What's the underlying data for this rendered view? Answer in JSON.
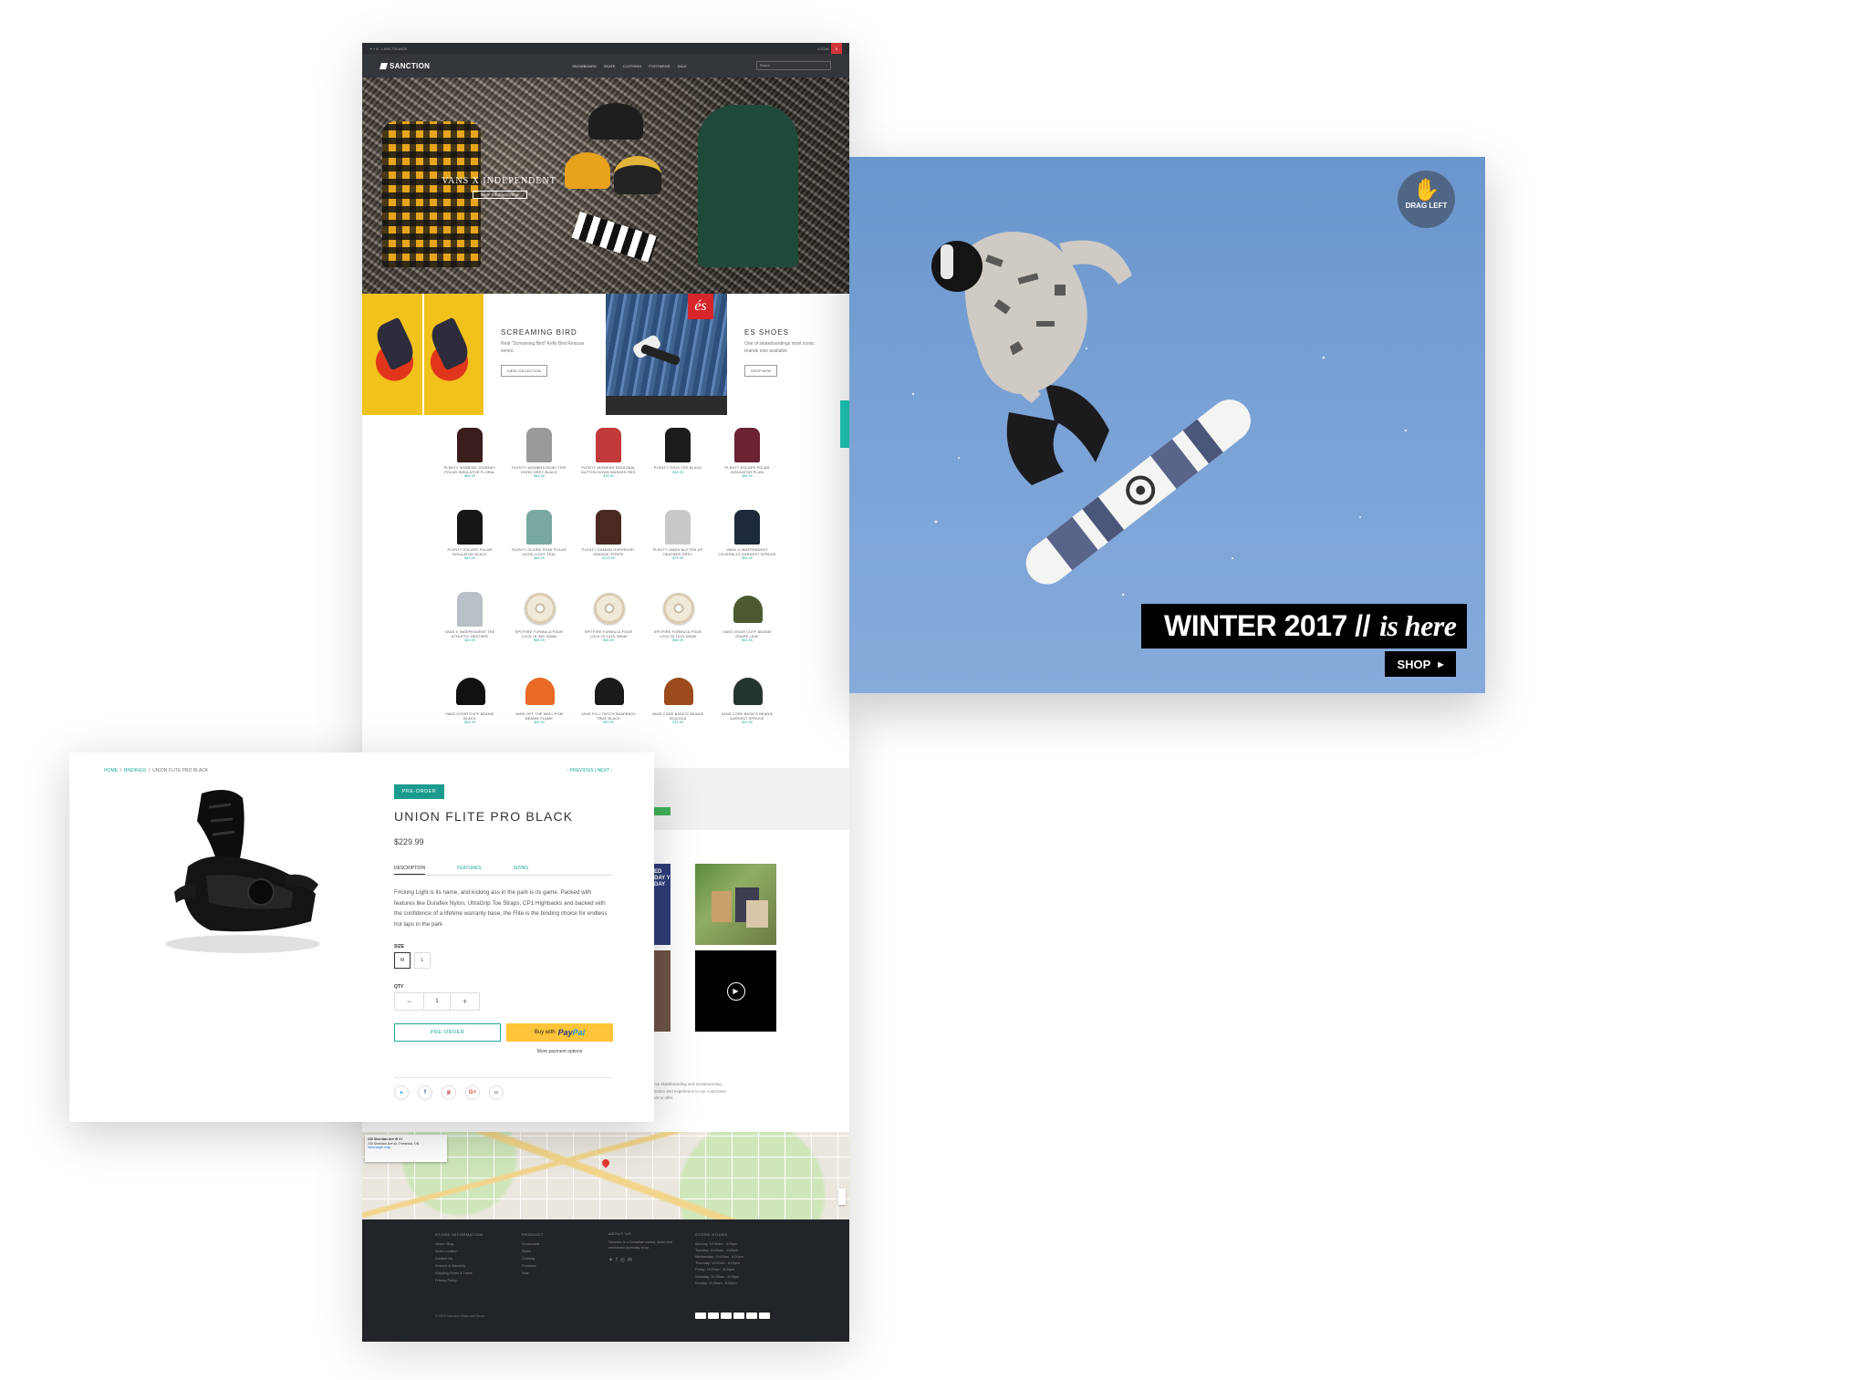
{
  "site": {
    "topbar": {
      "phone": "1-800-728-8625",
      "login": "LOGIN",
      "cart_count": "0"
    },
    "logo_text": "SANCTION",
    "nav": [
      "SNOWBOARD",
      "SKATE",
      "CLOTHING",
      "FOOTWEAR",
      "SALE"
    ],
    "search_placeholder": "Search",
    "hero": {
      "title": "VANS X INDEPENDENT",
      "button": "SHOP THE COLLECTION"
    },
    "promos": [
      {
        "title": "SCREAMING BIRD",
        "text": "Real \"Screaming Bird\" Kelly Bird Reissue series.",
        "button": "VIEW COLLECTION"
      },
      {
        "title": "ES SHOES",
        "text": "One of skateboardings most iconic brands now available",
        "button": "SHOP NOW"
      }
    ],
    "side_tab": "SIGNUP",
    "products": [
      {
        "name": "PLENTY WOMENS JOURNEY POLAR INSULATOR FLORAL",
        "price": "$59.99",
        "kind": "shirt",
        "color": "#3a1d1d"
      },
      {
        "name": "PLENTY WOMENS ROAD TRIP HOOD GREY BLACK",
        "price": "$64.99",
        "kind": "shirt",
        "color": "#9a9a9a"
      },
      {
        "name": "PLENTY WOMENS SEASONAL BUTTON DOWN WASHED RED",
        "price": "$79.99",
        "kind": "shirt",
        "color": "#c23a3a"
      },
      {
        "name": "PLENTY THUG TEE BLACK",
        "price": "$34.99",
        "kind": "shirt",
        "color": "#1c1c1c"
      },
      {
        "name": "PLENTY ESCAPE POLAR INSULATOR PLUM",
        "price": "$49.99",
        "kind": "shirt",
        "color": "#6b2233"
      },
      {
        "name": "PLENTY ESCAPE POLAR INSULATOR BLACK",
        "price": "$49.99",
        "kind": "shirt",
        "color": "#161616"
      },
      {
        "name": "PLENTY OLIVER PEAK POLAR HOOD LIGHT TEAL",
        "price": "$69.99",
        "kind": "shirt",
        "color": "#78a8a0"
      },
      {
        "name": "PLENTY DAMIAN OVERSHIRT ORANGE STRIPE",
        "price": "$119.99",
        "kind": "shirt",
        "color": "#4a2a20"
      },
      {
        "name": "PLENTY OWEN BUTTON UP HEATHER GREY",
        "price": "$74.99",
        "kind": "shirt",
        "color": "#c8c8c8"
      },
      {
        "name": "VANS X INDEPENDENT COVERALLS DARKEST SPRUCE",
        "price": "$95.00",
        "kind": "shirt",
        "color": "#1c2a3c"
      },
      {
        "name": "VANS X INDEPENDENT TEE ATHLETIC HEATHER",
        "price": "$29.99",
        "kind": "shirt",
        "color": "#b9bfc6"
      },
      {
        "name": "SPITFIRE FORMULA FOUR LOCK IN 99D 52MM",
        "price": "$54.99",
        "kind": "wheel",
        "color": "#f1e9d8"
      },
      {
        "name": "SPITFIRE FORMULA FOUR LOCK IN 101D 53MM",
        "price": "$56.99",
        "kind": "wheel",
        "color": "#f1e9d8"
      },
      {
        "name": "SPITFIRE FORMULA FOUR LOCK IN 101D 53MM",
        "price": "$56.99",
        "kind": "wheel",
        "color": "#f1e9d8"
      },
      {
        "name": "VANS VISOR CUFF BEANIE GRAPE LEAF",
        "price": "$24.99",
        "kind": "beanie",
        "color": "#4d5a31"
      },
      {
        "name": "VANS VISOR CUFF BEANIE BLACK",
        "price": "$24.99",
        "kind": "beanie",
        "color": "#111111"
      },
      {
        "name": "VANS OFF THE WALL POM BEANIE FLAME",
        "price": "$29.99",
        "kind": "beanie",
        "color": "#e86a24"
      },
      {
        "name": "VANS FULL PATCH SNAPBACK TRUE BLACK",
        "price": "$29.99",
        "kind": "beanie",
        "color": "#1a1a1a"
      },
      {
        "name": "VANS CORE BASICS BEANIE SEQUOIA",
        "price": "$19.99",
        "kind": "beanie",
        "color": "#9c4a1e"
      },
      {
        "name": "VANS CORE BASICS BEANIE DARKEST SPRUCE",
        "price": "$19.99",
        "kind": "beanie",
        "color": "#23362d"
      }
    ],
    "instagram_text": "ED DAY Y DAY",
    "about_snippet": [
      "love skateboarding and snowboarding",
      "llection and experience to our customers",
      "ave to offer."
    ],
    "map_card": {
      "title": "230 Sheridan Ave W #1",
      "address": "230 Sheridan Ave W, Threshold, ON",
      "link": "View larger map"
    },
    "footer": {
      "columns": [
        {
          "title": "STORE INFORMATION",
          "items": [
            "News / Blog",
            "Store Location",
            "Contact Us",
            "Returns & Warranty",
            "Shipping Terms & Taxes",
            "Privacy Policy"
          ]
        },
        {
          "title": "PRODUCT",
          "items": [
            "Snowboard",
            "Skate",
            "Clothing",
            "Footwear",
            "Sale"
          ]
        },
        {
          "title": "ABOUT US",
          "items": [
            "Sanction is a Canadian owned, skate and snowboard specialty shop."
          ]
        },
        {
          "title": "STORE HOURS",
          "items": [
            "Monday: 10:00am - 6:00pm",
            "Tuesday: 10:00am - 6:00pm",
            "Wednesday: 10:00am - 6:00pm",
            "Thursday: 10:00am - 8:00pm",
            "Friday: 10:00am - 8:00pm",
            "Saturday: 10:00am - 6:00pm",
            "Sunday: 11:00am - 5:00pm"
          ]
        }
      ],
      "copyright": "© 2018 Sanction Skate and Snow"
    }
  },
  "banner": {
    "drag_label": "DRAG LEFT",
    "headline": "WINTER 2017 //",
    "headline_script": "is here",
    "shop": "SHOP"
  },
  "product": {
    "breadcrumb": [
      "HOME",
      "BINDINGS",
      "UNION FLITE PRO BLACK"
    ],
    "pager": "‹ PREVIOUS | NEXT ›",
    "badge": "PRE-ORDER",
    "title": "UNION FLITE PRO BLACK",
    "price": "$229.99",
    "tabs": [
      "DESCRIPTION",
      "FEATURES",
      "SIZING"
    ],
    "description": "F#cking Light is its name, and kicking ass in the park is its game. Packed with features like Duraflex Nylon, UltraGrip Toe Straps, CP1 Highbacks and backed with the confidence of a lifetime warranty base, the Flite is the binding choice for endless hot laps in the park",
    "size_label": "SIZE",
    "sizes": [
      "M",
      "L"
    ],
    "qty_label": "QTY",
    "qty_value": "1",
    "preorder_button": "PRE-ORDER",
    "paypal_prefix": "Buy with",
    "paypal_brand_a": "Pay",
    "paypal_brand_b": "Pal",
    "more_payment": "More payment options",
    "share_icons": [
      "twitter-icon",
      "facebook-icon",
      "pinterest-icon",
      "googleplus-icon",
      "email-icon"
    ]
  },
  "colors": {
    "accent_teal": "#1fa89a",
    "dark": "#212529",
    "cart_red": "#d0363a",
    "paypal_yellow": "#ffc439",
    "sky": "#7aa2d6"
  }
}
